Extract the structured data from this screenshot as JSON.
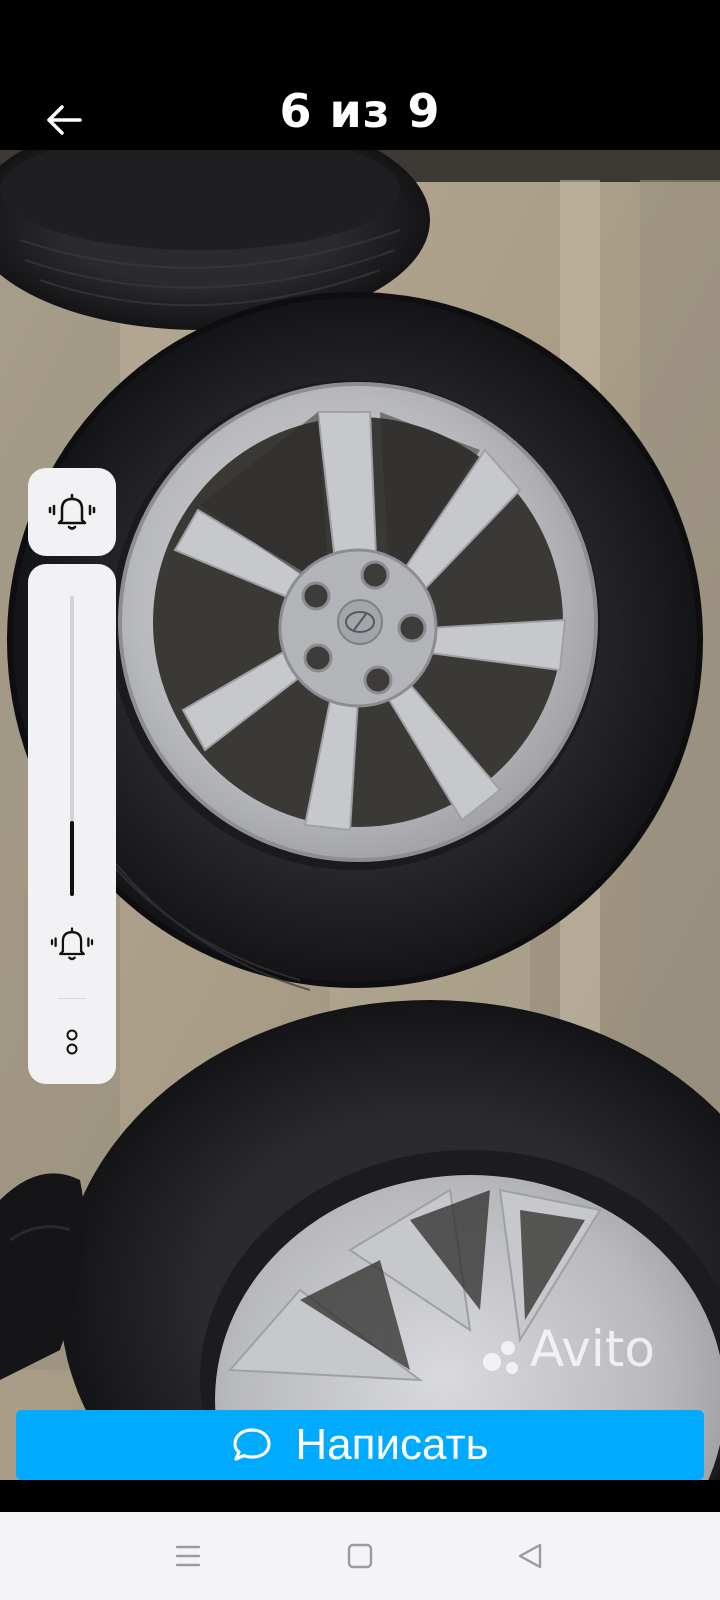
{
  "header": {
    "counter": "6 из 9",
    "back_icon": "arrow-left-icon"
  },
  "photo": {
    "watermark": "Avito"
  },
  "volume_panel": {
    "top_icon": "bell-ring-icon",
    "level_fraction": 0.25,
    "ring_icon": "bell-ring-icon",
    "more_icon": "more-dots-icon"
  },
  "action": {
    "write_label": "Написать",
    "write_icon": "chat-bubble-icon",
    "accent_color": "#00aaff"
  },
  "nav_bar": {
    "menu_icon": "menu-icon",
    "home_icon": "square-home-icon",
    "back_icon": "triangle-back-icon"
  }
}
